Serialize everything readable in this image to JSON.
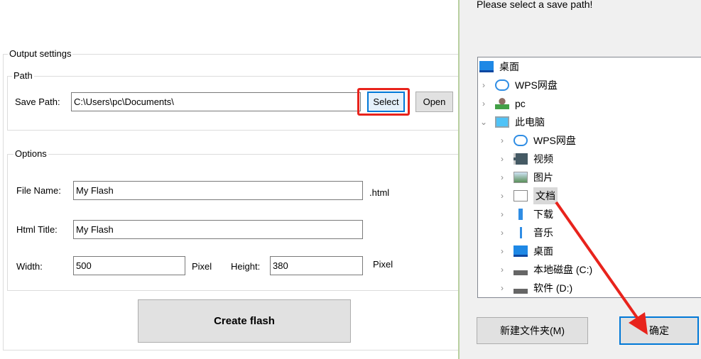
{
  "output_settings": {
    "title": "Output settings"
  },
  "path": {
    "title": "Path",
    "save_path_label": "Save Path:",
    "save_path_value": "C:\\Users\\pc\\Documents\\",
    "select_label": "Select",
    "open_label": "Open"
  },
  "options": {
    "title": "Options",
    "file_name_label": "File Name:",
    "file_name_value": "My Flash",
    "file_ext": ".html",
    "html_title_label": "Html Title:",
    "html_title_value": "My Flash",
    "width_label": "Width:",
    "width_value": "500",
    "width_unit": "Pixel",
    "height_label": "Height:",
    "height_value": "380",
    "height_unit": "Pixel"
  },
  "create_label": "Create flash",
  "dialog": {
    "prompt": "Please select a save path!",
    "tree": [
      {
        "label": "桌面",
        "icon": "desktop-icon",
        "level": 0,
        "chevron": ""
      },
      {
        "label": "WPS网盘",
        "icon": "cloud-icon",
        "level": 0,
        "chevron": "›"
      },
      {
        "label": "pc",
        "icon": "user-icon",
        "level": 0,
        "chevron": "›"
      },
      {
        "label": "此电脑",
        "icon": "computer-icon",
        "level": 0,
        "chevron": "⌄"
      },
      {
        "label": "WPS网盘",
        "icon": "cloud-icon",
        "level": 1,
        "chevron": "›"
      },
      {
        "label": "视频",
        "icon": "video-icon",
        "level": 1,
        "chevron": "›"
      },
      {
        "label": "图片",
        "icon": "picture-icon",
        "level": 1,
        "chevron": "›"
      },
      {
        "label": "文档",
        "icon": "document-icon",
        "level": 1,
        "chevron": "›",
        "selected": true
      },
      {
        "label": "下载",
        "icon": "download-icon",
        "level": 1,
        "chevron": "›"
      },
      {
        "label": "音乐",
        "icon": "music-icon",
        "level": 1,
        "chevron": "›"
      },
      {
        "label": "桌面",
        "icon": "desktop-icon",
        "level": 1,
        "chevron": "›"
      },
      {
        "label": "本地磁盘 (C:)",
        "icon": "drive-icon",
        "level": 1,
        "chevron": "›"
      },
      {
        "label": "软件 (D:)",
        "icon": "drive-icon",
        "level": 1,
        "chevron": "›"
      }
    ],
    "new_folder_label": "新建文件夹(M)",
    "ok_label": "确定"
  },
  "colors": {
    "highlight": "#e8231c",
    "focus": "#0078d7"
  }
}
